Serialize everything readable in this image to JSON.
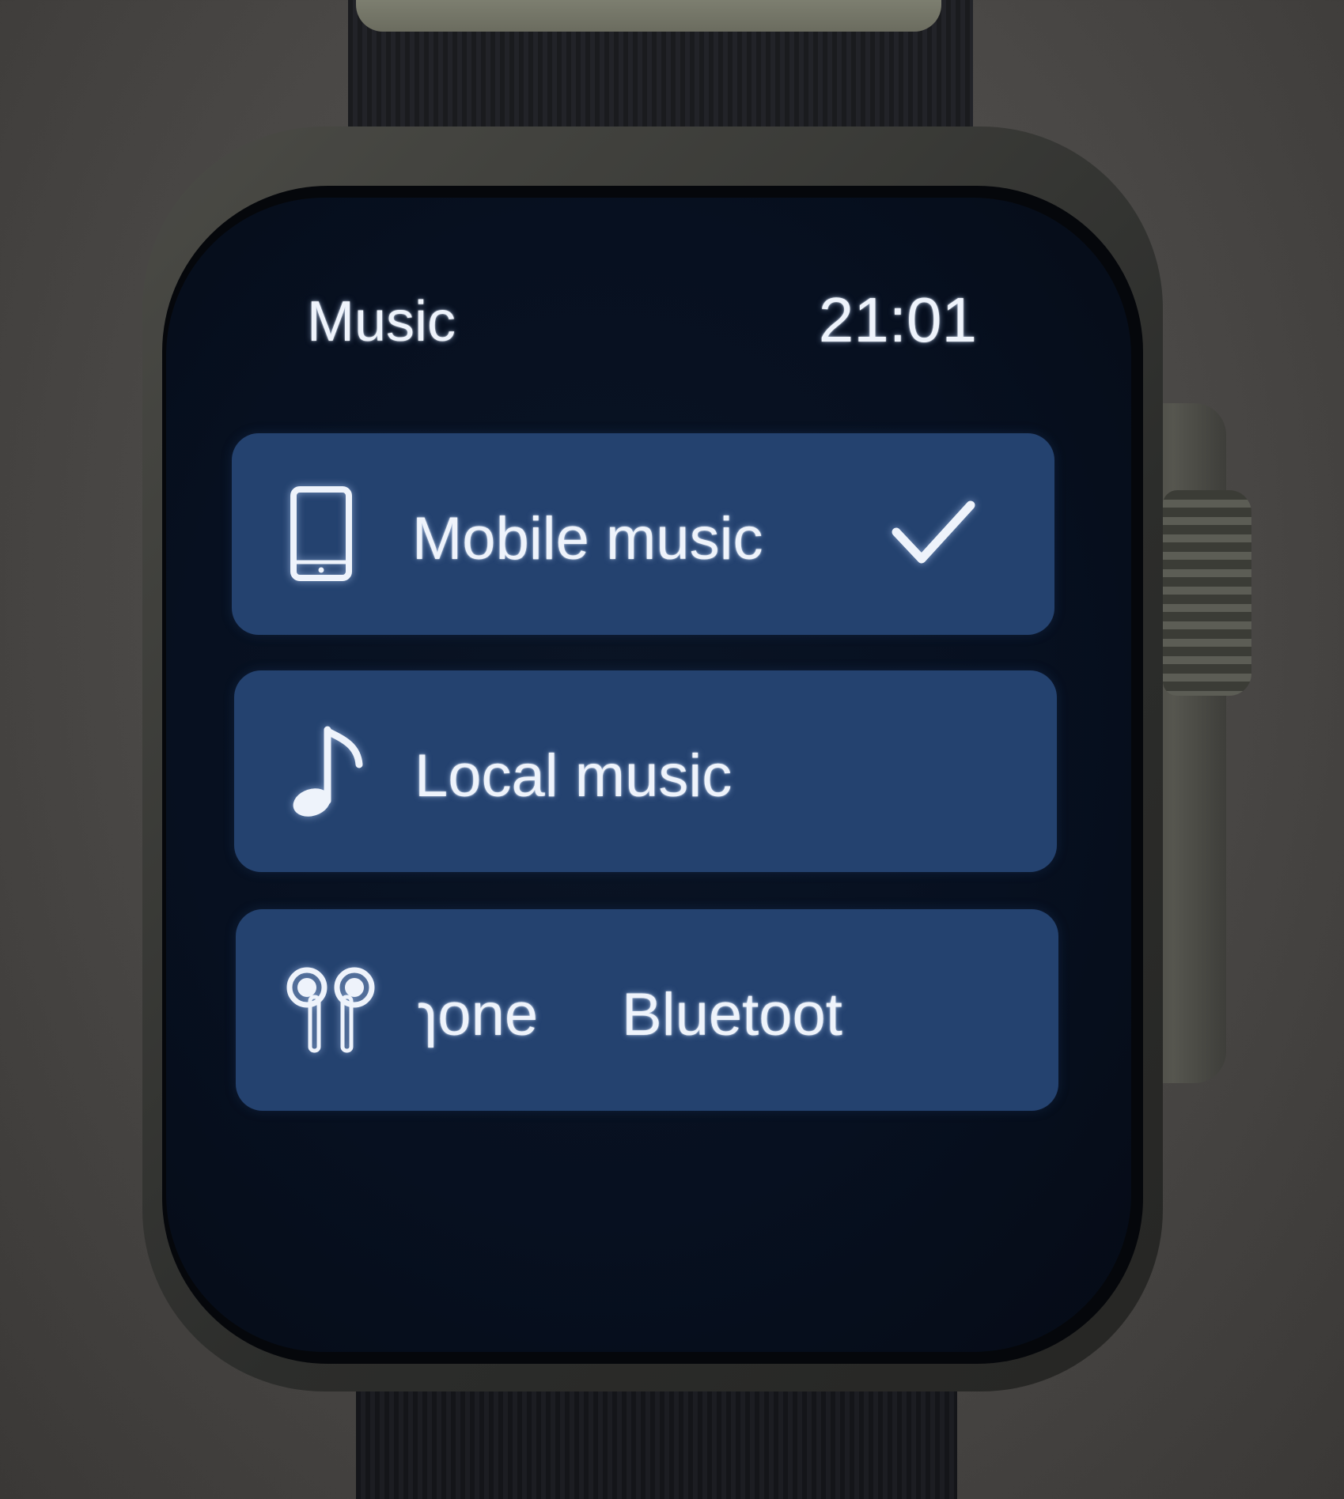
{
  "header": {
    "title": "Music",
    "time": "21:01"
  },
  "menu": {
    "items": [
      {
        "label": "Mobile music",
        "icon": "phone-icon",
        "selected": true
      },
      {
        "label": "Local music",
        "icon": "music-note-icon",
        "selected": false
      },
      {
        "label": "ɿone",
        "label_part2": "Bluetoot",
        "icon": "earbuds-icon",
        "selected": false
      }
    ]
  },
  "colors": {
    "item_background": "#24426f",
    "screen_background": "#071020",
    "text": "#eef3fb"
  }
}
